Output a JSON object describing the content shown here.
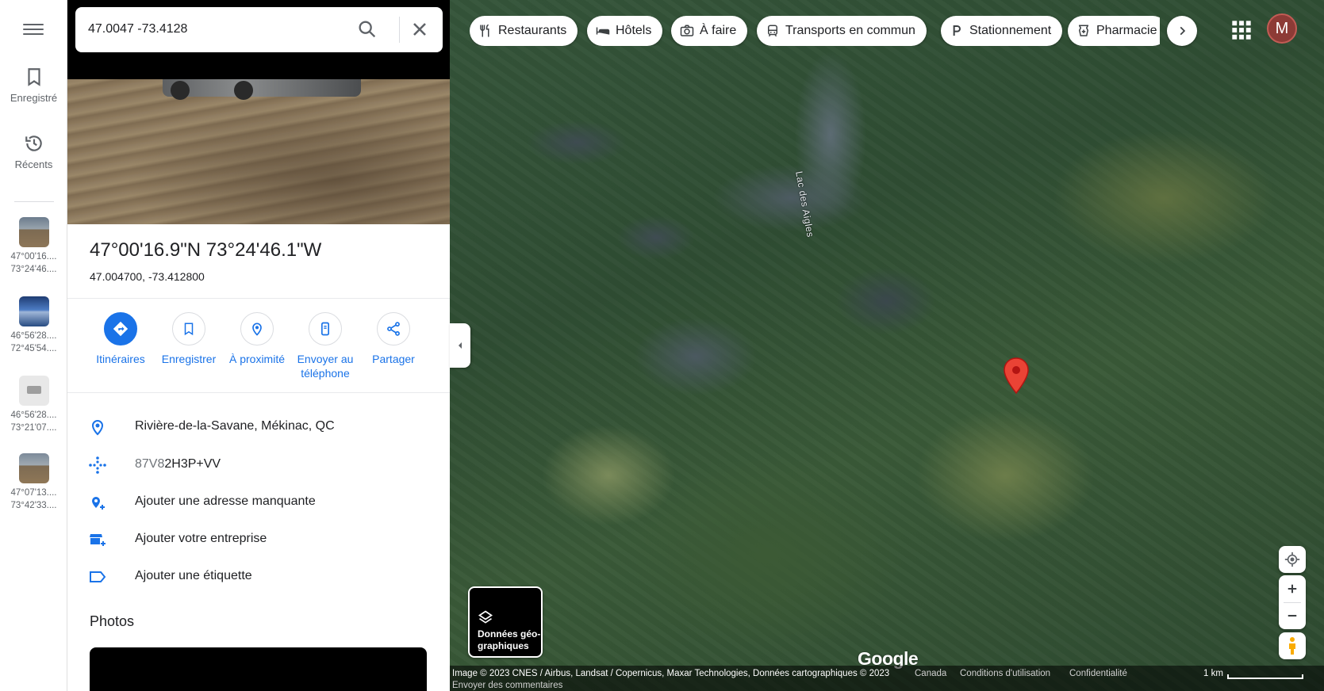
{
  "search": {
    "value": "47.0047 -73.4128"
  },
  "rail": {
    "saved_label": "Enregistré",
    "recents_label": "Récents",
    "recent_items": [
      {
        "line1": "47°00'16....",
        "line2": "73°24'46...."
      },
      {
        "line1": "46°56'28....",
        "line2": "72°45'54...."
      },
      {
        "line1": "46°56'28....",
        "line2": "73°21'07...."
      },
      {
        "line1": "47°07'13....",
        "line2": "73°42'33...."
      }
    ]
  },
  "place": {
    "title": "47°00'16.9\"N 73°24'46.1\"W",
    "subtitle": "47.004700, -73.412800"
  },
  "actions": [
    {
      "label": "Itinéraires",
      "icon": "directions-icon"
    },
    {
      "label": "Enregistrer",
      "icon": "bookmark-icon"
    },
    {
      "label": "À proximité",
      "icon": "nearby-icon"
    },
    {
      "label_line1": "Envoyer au",
      "label_line2": "téléphone",
      "icon": "phone-icon"
    },
    {
      "label": "Partager",
      "icon": "share-icon"
    }
  ],
  "info": {
    "address": "Rivière-de-la-Savane, Mékinac, QC",
    "pluscode_prefix": "87V8",
    "pluscode_rest": "2H3P+VV",
    "add_address": "Ajouter une adresse manquante",
    "add_business": "Ajouter votre entreprise",
    "add_label": "Ajouter une étiquette"
  },
  "photos_heading": "Photos",
  "map": {
    "lake_label": "Lac des Aigles",
    "chips": [
      {
        "label": "Restaurants",
        "icon": "restaurant-icon"
      },
      {
        "label": "Hôtels",
        "icon": "hotel-icon"
      },
      {
        "label": "À faire",
        "icon": "camera-icon"
      },
      {
        "label": "Transports en commun",
        "icon": "transit-icon"
      },
      {
        "label": "Stationnement",
        "icon": "parking-icon"
      },
      {
        "label": "Pharmacie",
        "icon": "pharmacy-icon"
      }
    ],
    "avatar_letter": "M",
    "layers_label_line1": "Données géo-",
    "layers_label_line2": "graphiques",
    "google_logo": "Google",
    "footer": {
      "attribution": "Image © 2023 CNES / Airbus, Landsat / Copernicus, Maxar Technologies, Données cartographiques © 2023",
      "country": "Canada",
      "terms": "Conditions d'utilisation",
      "privacy": "Confidentialité",
      "feedback": "Envoyer des commentaires",
      "scale": "1 km"
    }
  },
  "colors": {
    "accent": "#1a73e8",
    "pin": "#ea4335",
    "avatar": "#8d3b36"
  }
}
